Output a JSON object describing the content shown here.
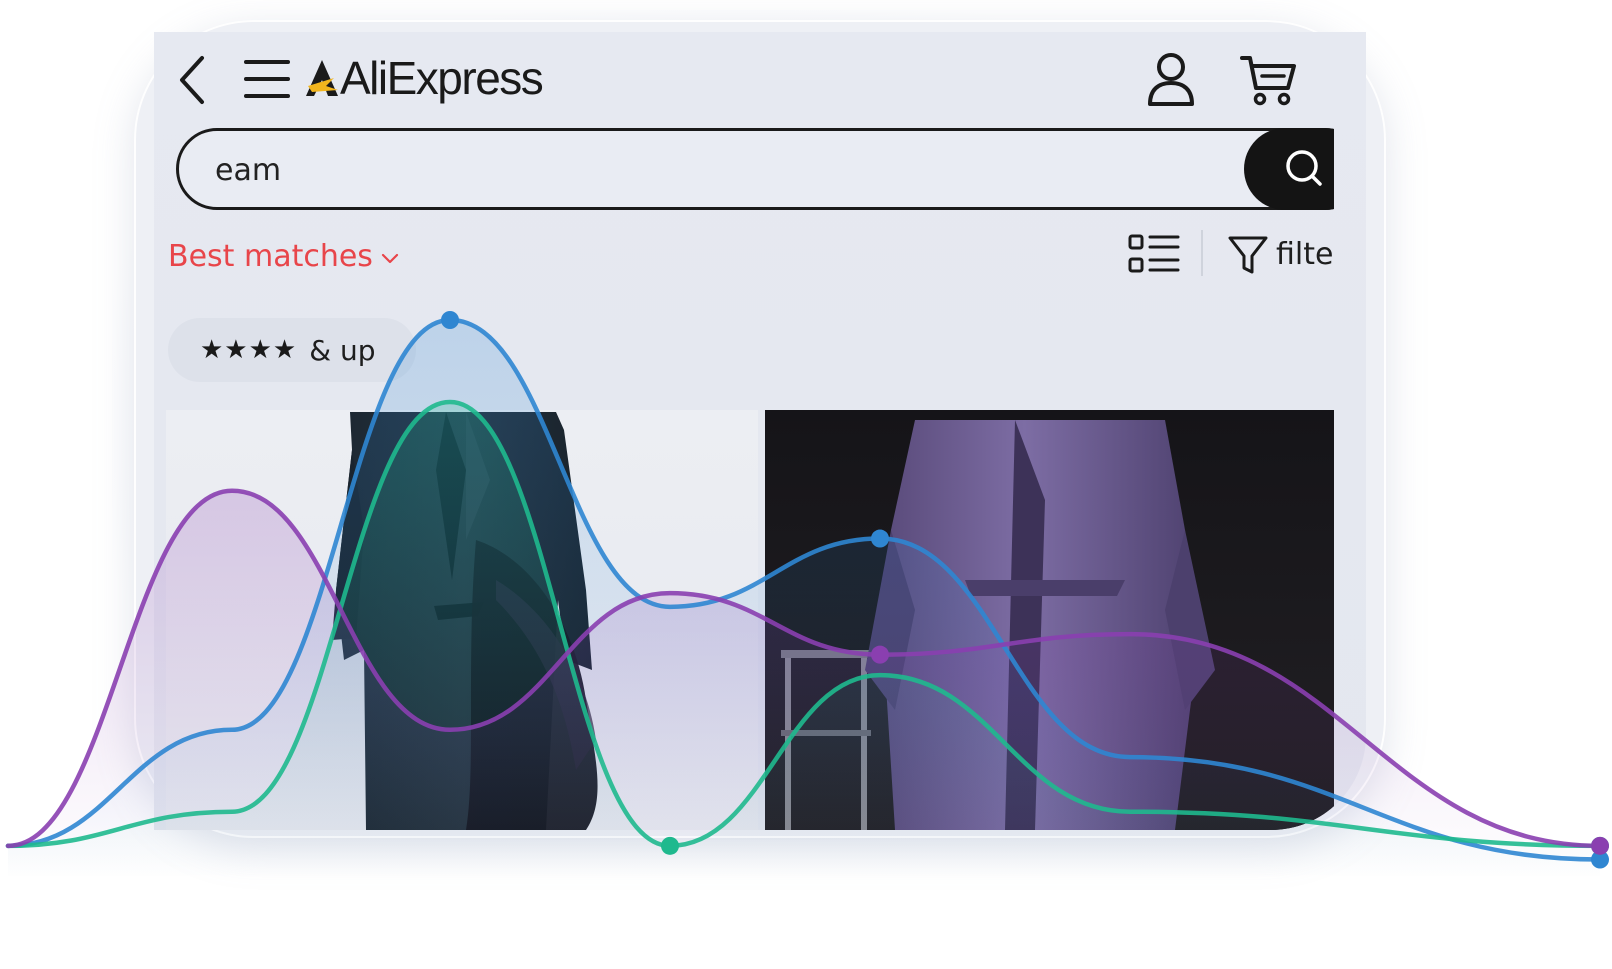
{
  "header": {
    "logo_text": "AliExpress",
    "icons": {
      "back": "back-arrow-icon",
      "menu": "hamburger-menu-icon",
      "account": "user-account-icon",
      "cart": "shopping-cart-icon"
    }
  },
  "search": {
    "value": "eam",
    "button_icon": "search-icon"
  },
  "sort": {
    "label": "Best matches",
    "caret_icon": "chevron-down-icon"
  },
  "toolbar": {
    "view_icon": "list-view-icon",
    "filter_icon": "funnel-filter-icon",
    "filter_label": "filte"
  },
  "rating_filter": {
    "stars": "★★★★",
    "label": "& up"
  },
  "products": [
    {
      "name": "dark-coat-with-tulle-hem"
    },
    {
      "name": "purple-oversized-trench-coat"
    }
  ],
  "colors": {
    "accent_red": "#e8454a",
    "search_button": "#141414",
    "series_blue": "#2f86d1",
    "series_green": "#1fb98e",
    "series_purple": "#8a3fb0"
  },
  "chart_data": {
    "type": "line",
    "series": [
      {
        "color": "#2f86d1",
        "values": [
          0.05,
          0.22,
          0.82,
          0.4,
          0.5,
          0.18,
          0.03
        ]
      },
      {
        "color": "#1fb98e",
        "values": [
          0.05,
          0.1,
          0.7,
          0.05,
          0.3,
          0.1,
          0.05
        ]
      },
      {
        "color": "#8a3fb0",
        "values": [
          0.05,
          0.57,
          0.22,
          0.42,
          0.33,
          0.36,
          0.05
        ]
      }
    ],
    "highlighted_points": [
      {
        "series": 0,
        "index": 2
      },
      {
        "series": 0,
        "index": 4
      },
      {
        "series": 0,
        "index": 6
      },
      {
        "series": 1,
        "index": 3
      },
      {
        "series": 1,
        "index": 6
      },
      {
        "series": 2,
        "index": 4
      },
      {
        "series": 2,
        "index": 6
      }
    ],
    "grid": false,
    "axes_visible": false
  }
}
